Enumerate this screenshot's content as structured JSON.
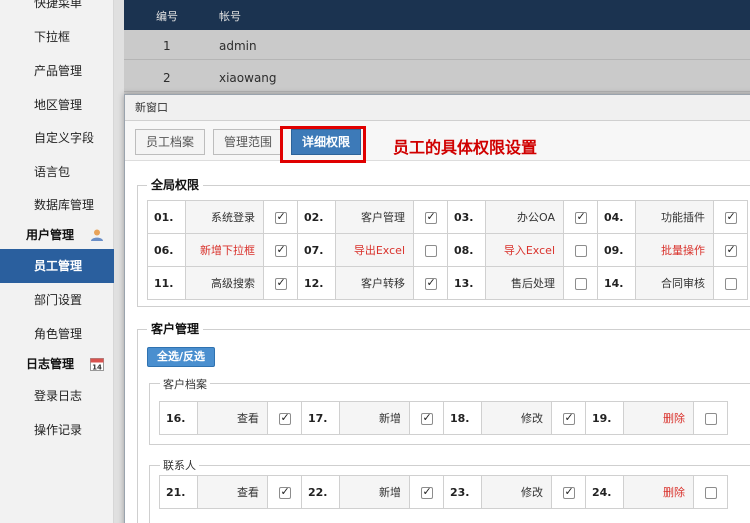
{
  "sidebar": {
    "items": [
      {
        "label": "快捷菜单"
      },
      {
        "label": "下拉框"
      },
      {
        "label": "产品管理"
      },
      {
        "label": "地区管理"
      },
      {
        "label": "自定义字段"
      },
      {
        "label": "语言包"
      },
      {
        "label": "数据库管理"
      }
    ],
    "group_user": {
      "label": "用户管理",
      "icon": "user-icon"
    },
    "user_items": [
      {
        "label": "员工管理",
        "active": true
      },
      {
        "label": "部门设置"
      },
      {
        "label": "角色管理"
      }
    ],
    "group_log": {
      "label": "日志管理",
      "icon": "calendar-icon",
      "badge": "14"
    },
    "log_items": [
      {
        "label": "登录日志"
      },
      {
        "label": "操作记录"
      }
    ]
  },
  "background_table": {
    "headers": [
      "编号",
      "帐号"
    ],
    "rows": [
      {
        "id": "1",
        "account": "admin"
      },
      {
        "id": "2",
        "account": "xiaowang"
      }
    ]
  },
  "dialog": {
    "title": "新窗口",
    "tabs": [
      {
        "label": "员工档案"
      },
      {
        "label": "管理范围"
      },
      {
        "label": "详细权限",
        "active": true
      }
    ],
    "annotation": "员工的具体权限设置",
    "global": {
      "legend": "全局权限",
      "rows": [
        [
          {
            "num": "01.",
            "label": "系统登录",
            "checked": true
          },
          {
            "num": "02.",
            "label": "客户管理",
            "checked": true
          },
          {
            "num": "03.",
            "label": "办公OA",
            "checked": true
          },
          {
            "num": "04.",
            "label": "功能插件",
            "checked": true
          }
        ],
        [
          {
            "num": "06.",
            "label": "新增下拉框",
            "checked": true,
            "red": true
          },
          {
            "num": "07.",
            "label": "导出Excel",
            "checked": false,
            "red": true
          },
          {
            "num": "08.",
            "label": "导入Excel",
            "checked": false,
            "red": true
          },
          {
            "num": "09.",
            "label": "批量操作",
            "checked": true,
            "red": true
          }
        ],
        [
          {
            "num": "11.",
            "label": "高级搜索",
            "checked": true
          },
          {
            "num": "12.",
            "label": "客户转移",
            "checked": true
          },
          {
            "num": "13.",
            "label": "售后处理",
            "checked": false
          },
          {
            "num": "14.",
            "label": "合同审核",
            "checked": false
          }
        ]
      ]
    },
    "customer": {
      "legend": "客户管理",
      "select_all": "全选/反选",
      "archive": {
        "legend": "客户档案",
        "cells": [
          {
            "num": "16.",
            "label": "查看",
            "checked": true
          },
          {
            "num": "17.",
            "label": "新增",
            "checked": true
          },
          {
            "num": "18.",
            "label": "修改",
            "checked": true
          },
          {
            "num": "19.",
            "label": "删除",
            "checked": false,
            "red": true
          }
        ]
      },
      "contact": {
        "legend": "联系人",
        "cells": [
          {
            "num": "21.",
            "label": "查看",
            "checked": true
          },
          {
            "num": "22.",
            "label": "新增",
            "checked": true
          },
          {
            "num": "23.",
            "label": "修改",
            "checked": true
          },
          {
            "num": "24.",
            "label": "删除",
            "checked": false,
            "red": true
          }
        ]
      }
    }
  },
  "colors": {
    "sidebar_active": "#2a5f9e",
    "tab_active": "#3d7ab8",
    "annotation": "#d00000",
    "danger_label": "#d9312b",
    "table_header": "#1f3b5c"
  }
}
